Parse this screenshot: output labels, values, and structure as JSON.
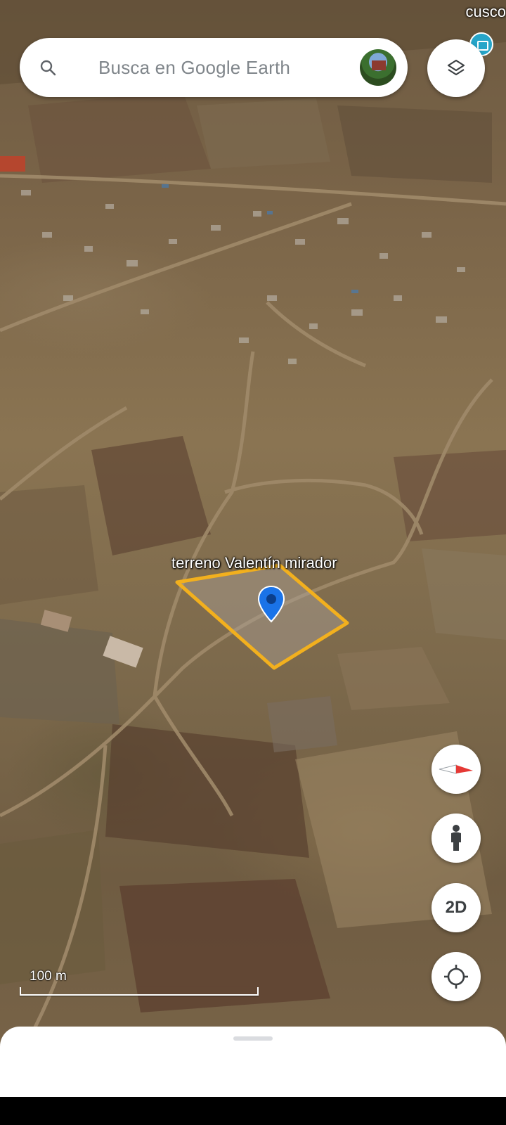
{
  "search": {
    "placeholder": "Busca en Google Earth"
  },
  "map": {
    "region_label": "cusco",
    "place_label": "terreno Valentín mirador",
    "scale_label": "100 m"
  },
  "controls": {
    "view_mode_label": "2D"
  },
  "icons": {
    "search": "search-icon",
    "layers": "layers-icon",
    "compass": "compass-icon",
    "streetview": "pegman-icon",
    "location": "my-location-icon",
    "pin": "map-pin-icon"
  },
  "colors": {
    "polygon_stroke": "#f2b01e",
    "pin": "#1a73e8",
    "compass_red": "#e53935"
  }
}
